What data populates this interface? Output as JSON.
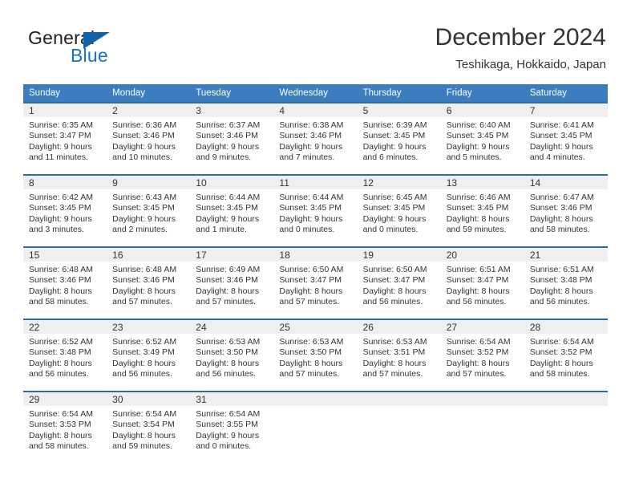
{
  "brand": {
    "name_part1": "General",
    "name_part2": "Blue",
    "accent_color": "#1372c4",
    "triangle_color": "#1362a8"
  },
  "header": {
    "title": "December 2024",
    "subtitle": "Teshikaga, Hokkaido, Japan"
  },
  "theme": {
    "header_row_bg": "#3b7dbf",
    "week_separator": "#2e6da4",
    "daynum_bg": "#efeff0",
    "text": "#333333"
  },
  "calendar": {
    "weekday_headers": [
      "Sunday",
      "Monday",
      "Tuesday",
      "Wednesday",
      "Thursday",
      "Friday",
      "Saturday"
    ],
    "weeks": [
      [
        {
          "day": "1",
          "sunrise": "Sunrise: 6:35 AM",
          "sunset": "Sunset: 3:47 PM",
          "daylight_line1": "Daylight: 9 hours",
          "daylight_line2": "and 11 minutes."
        },
        {
          "day": "2",
          "sunrise": "Sunrise: 6:36 AM",
          "sunset": "Sunset: 3:46 PM",
          "daylight_line1": "Daylight: 9 hours",
          "daylight_line2": "and 10 minutes."
        },
        {
          "day": "3",
          "sunrise": "Sunrise: 6:37 AM",
          "sunset": "Sunset: 3:46 PM",
          "daylight_line1": "Daylight: 9 hours",
          "daylight_line2": "and 9 minutes."
        },
        {
          "day": "4",
          "sunrise": "Sunrise: 6:38 AM",
          "sunset": "Sunset: 3:46 PM",
          "daylight_line1": "Daylight: 9 hours",
          "daylight_line2": "and 7 minutes."
        },
        {
          "day": "5",
          "sunrise": "Sunrise: 6:39 AM",
          "sunset": "Sunset: 3:45 PM",
          "daylight_line1": "Daylight: 9 hours",
          "daylight_line2": "and 6 minutes."
        },
        {
          "day": "6",
          "sunrise": "Sunrise: 6:40 AM",
          "sunset": "Sunset: 3:45 PM",
          "daylight_line1": "Daylight: 9 hours",
          "daylight_line2": "and 5 minutes."
        },
        {
          "day": "7",
          "sunrise": "Sunrise: 6:41 AM",
          "sunset": "Sunset: 3:45 PM",
          "daylight_line1": "Daylight: 9 hours",
          "daylight_line2": "and 4 minutes."
        }
      ],
      [
        {
          "day": "8",
          "sunrise": "Sunrise: 6:42 AM",
          "sunset": "Sunset: 3:45 PM",
          "daylight_line1": "Daylight: 9 hours",
          "daylight_line2": "and 3 minutes."
        },
        {
          "day": "9",
          "sunrise": "Sunrise: 6:43 AM",
          "sunset": "Sunset: 3:45 PM",
          "daylight_line1": "Daylight: 9 hours",
          "daylight_line2": "and 2 minutes."
        },
        {
          "day": "10",
          "sunrise": "Sunrise: 6:44 AM",
          "sunset": "Sunset: 3:45 PM",
          "daylight_line1": "Daylight: 9 hours",
          "daylight_line2": "and 1 minute."
        },
        {
          "day": "11",
          "sunrise": "Sunrise: 6:44 AM",
          "sunset": "Sunset: 3:45 PM",
          "daylight_line1": "Daylight: 9 hours",
          "daylight_line2": "and 0 minutes."
        },
        {
          "day": "12",
          "sunrise": "Sunrise: 6:45 AM",
          "sunset": "Sunset: 3:45 PM",
          "daylight_line1": "Daylight: 9 hours",
          "daylight_line2": "and 0 minutes."
        },
        {
          "day": "13",
          "sunrise": "Sunrise: 6:46 AM",
          "sunset": "Sunset: 3:45 PM",
          "daylight_line1": "Daylight: 8 hours",
          "daylight_line2": "and 59 minutes."
        },
        {
          "day": "14",
          "sunrise": "Sunrise: 6:47 AM",
          "sunset": "Sunset: 3:46 PM",
          "daylight_line1": "Daylight: 8 hours",
          "daylight_line2": "and 58 minutes."
        }
      ],
      [
        {
          "day": "15",
          "sunrise": "Sunrise: 6:48 AM",
          "sunset": "Sunset: 3:46 PM",
          "daylight_line1": "Daylight: 8 hours",
          "daylight_line2": "and 58 minutes."
        },
        {
          "day": "16",
          "sunrise": "Sunrise: 6:48 AM",
          "sunset": "Sunset: 3:46 PM",
          "daylight_line1": "Daylight: 8 hours",
          "daylight_line2": "and 57 minutes."
        },
        {
          "day": "17",
          "sunrise": "Sunrise: 6:49 AM",
          "sunset": "Sunset: 3:46 PM",
          "daylight_line1": "Daylight: 8 hours",
          "daylight_line2": "and 57 minutes."
        },
        {
          "day": "18",
          "sunrise": "Sunrise: 6:50 AM",
          "sunset": "Sunset: 3:47 PM",
          "daylight_line1": "Daylight: 8 hours",
          "daylight_line2": "and 57 minutes."
        },
        {
          "day": "19",
          "sunrise": "Sunrise: 6:50 AM",
          "sunset": "Sunset: 3:47 PM",
          "daylight_line1": "Daylight: 8 hours",
          "daylight_line2": "and 56 minutes."
        },
        {
          "day": "20",
          "sunrise": "Sunrise: 6:51 AM",
          "sunset": "Sunset: 3:47 PM",
          "daylight_line1": "Daylight: 8 hours",
          "daylight_line2": "and 56 minutes."
        },
        {
          "day": "21",
          "sunrise": "Sunrise: 6:51 AM",
          "sunset": "Sunset: 3:48 PM",
          "daylight_line1": "Daylight: 8 hours",
          "daylight_line2": "and 56 minutes."
        }
      ],
      [
        {
          "day": "22",
          "sunrise": "Sunrise: 6:52 AM",
          "sunset": "Sunset: 3:48 PM",
          "daylight_line1": "Daylight: 8 hours",
          "daylight_line2": "and 56 minutes."
        },
        {
          "day": "23",
          "sunrise": "Sunrise: 6:52 AM",
          "sunset": "Sunset: 3:49 PM",
          "daylight_line1": "Daylight: 8 hours",
          "daylight_line2": "and 56 minutes."
        },
        {
          "day": "24",
          "sunrise": "Sunrise: 6:53 AM",
          "sunset": "Sunset: 3:50 PM",
          "daylight_line1": "Daylight: 8 hours",
          "daylight_line2": "and 56 minutes."
        },
        {
          "day": "25",
          "sunrise": "Sunrise: 6:53 AM",
          "sunset": "Sunset: 3:50 PM",
          "daylight_line1": "Daylight: 8 hours",
          "daylight_line2": "and 57 minutes."
        },
        {
          "day": "26",
          "sunrise": "Sunrise: 6:53 AM",
          "sunset": "Sunset: 3:51 PM",
          "daylight_line1": "Daylight: 8 hours",
          "daylight_line2": "and 57 minutes."
        },
        {
          "day": "27",
          "sunrise": "Sunrise: 6:54 AM",
          "sunset": "Sunset: 3:52 PM",
          "daylight_line1": "Daylight: 8 hours",
          "daylight_line2": "and 57 minutes."
        },
        {
          "day": "28",
          "sunrise": "Sunrise: 6:54 AM",
          "sunset": "Sunset: 3:52 PM",
          "daylight_line1": "Daylight: 8 hours",
          "daylight_line2": "and 58 minutes."
        }
      ],
      [
        {
          "day": "29",
          "sunrise": "Sunrise: 6:54 AM",
          "sunset": "Sunset: 3:53 PM",
          "daylight_line1": "Daylight: 8 hours",
          "daylight_line2": "and 58 minutes."
        },
        {
          "day": "30",
          "sunrise": "Sunrise: 6:54 AM",
          "sunset": "Sunset: 3:54 PM",
          "daylight_line1": "Daylight: 8 hours",
          "daylight_line2": "and 59 minutes."
        },
        {
          "day": "31",
          "sunrise": "Sunrise: 6:54 AM",
          "sunset": "Sunset: 3:55 PM",
          "daylight_line1": "Daylight: 9 hours",
          "daylight_line2": "and 0 minutes."
        },
        {
          "day": "",
          "sunrise": "",
          "sunset": "",
          "daylight_line1": "",
          "daylight_line2": ""
        },
        {
          "day": "",
          "sunrise": "",
          "sunset": "",
          "daylight_line1": "",
          "daylight_line2": ""
        },
        {
          "day": "",
          "sunrise": "",
          "sunset": "",
          "daylight_line1": "",
          "daylight_line2": ""
        },
        {
          "day": "",
          "sunrise": "",
          "sunset": "",
          "daylight_line1": "",
          "daylight_line2": ""
        }
      ]
    ]
  }
}
